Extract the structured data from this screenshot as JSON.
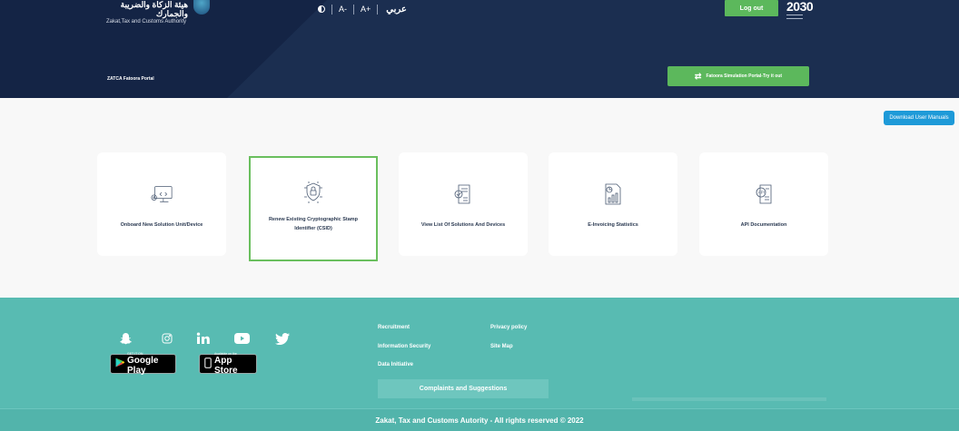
{
  "header": {
    "logo_ar": "هيئة الزكاة والضريبة والجمارك",
    "logo_en": "Zakat,Tax and Customs Authority",
    "font_small": "A-",
    "font_large": "A+",
    "language": "عربي",
    "logout_label": "Log out",
    "vision_number": "2030",
    "portal_title": "ZATCA Fatoora Portal",
    "simulation_label": "Fatoora Simulation Portal-Try it out"
  },
  "main": {
    "download_label": "Download User Manuals",
    "cards": [
      {
        "label": "Onboard New Solution Unit/Device",
        "icon": "monitor-gear-icon"
      },
      {
        "label": "Renew Existing Cryptographic Stamp Identifier (CSID)",
        "icon": "shield-lock-icon"
      },
      {
        "label": "View List Of Solutions And Devices",
        "icon": "document-check-icon"
      },
      {
        "label": "E-Invoicing Statistics",
        "icon": "bar-chart-document-icon"
      },
      {
        "label": "API Documentation",
        "icon": "api-document-icon"
      }
    ]
  },
  "footer": {
    "google_small": "GET IT ON",
    "google_big": "Google Play",
    "apple_small": "Available on the",
    "apple_big": "App Store",
    "links": {
      "recruitment": "Recruitment",
      "privacy": "Privacy policy",
      "infosec": "Information Security",
      "sitemap": "Site Map",
      "data": "Data Initiative"
    },
    "complaints_label": "Complaints and Suggestions",
    "copyright": "Zakat, Tax and Customs Autority - All rights reserved © 2022"
  },
  "colors": {
    "header_bg": "#142445",
    "accent_green": "#5cb85c",
    "active_border": "#6abf5e",
    "footer_bg": "#58bbb2",
    "download_blue": "#1e9ad8"
  }
}
